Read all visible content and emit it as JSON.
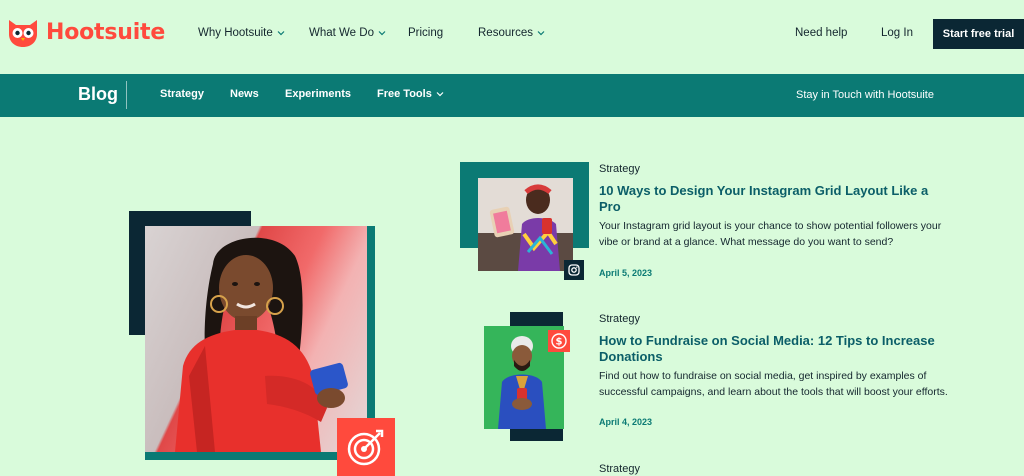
{
  "brand": {
    "name": "Hootsuite",
    "accent": "#ff4a3d",
    "dark": "#0b2734",
    "teal": "#0b7a74",
    "background": "#d9fbdb"
  },
  "topnav": {
    "items": [
      {
        "label": "Why Hootsuite",
        "has_dropdown": true
      },
      {
        "label": "What We Do",
        "has_dropdown": true
      },
      {
        "label": "Pricing",
        "has_dropdown": false
      },
      {
        "label": "Resources",
        "has_dropdown": true
      }
    ],
    "help": "Need help",
    "login": "Log In",
    "cta": "Start free trial"
  },
  "blogbar": {
    "title": "Blog",
    "links": [
      {
        "label": "Strategy"
      },
      {
        "label": "News"
      },
      {
        "label": "Experiments"
      },
      {
        "label": "Free Tools",
        "has_dropdown": true
      }
    ],
    "stay": "Stay in Touch with Hootsuite"
  },
  "hero": {
    "badge_icon": "target-icon"
  },
  "articles": [
    {
      "category": "Strategy",
      "title": "10 Ways to Design Your Instagram Grid Layout Like a Pro",
      "excerpt": "Your Instagram grid layout is your chance to show potential followers your vibe or brand at a glance. What message do you want to send?",
      "date": "April 5, 2023",
      "badge_icon": "instagram-icon"
    },
    {
      "category": "Strategy",
      "title": "How to Fundraise on Social Media: 12 Tips to Increase Donations",
      "excerpt": "Find out how to fundraise on social media, get inspired by examples of successful campaigns, and learn about the tools that will boost your efforts.",
      "date": "April 4, 2023",
      "badge_icon": "dollar-icon"
    },
    {
      "category": "Strategy"
    }
  ]
}
